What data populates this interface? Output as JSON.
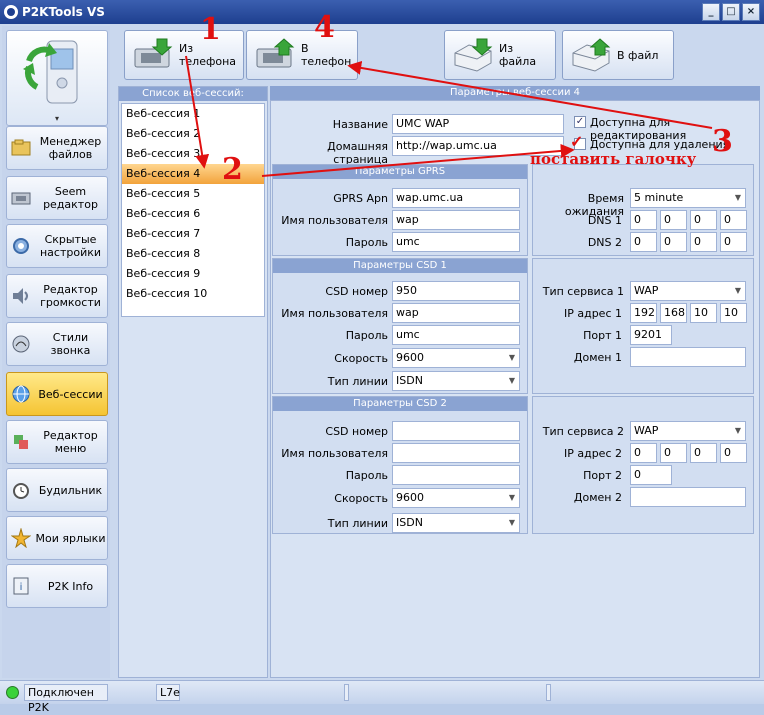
{
  "window": {
    "title": "P2KTools VS",
    "controls": [
      "_",
      "□",
      "×"
    ]
  },
  "nav": {
    "items": [
      {
        "label": "Менеджер\nфайлов",
        "icon": "file-manager-icon"
      },
      {
        "label": "Seem\nредактор",
        "icon": "seem-editor-icon"
      },
      {
        "label": "Скрытые\nнастройки",
        "icon": "hidden-settings-icon"
      },
      {
        "label": "Редактор\nгромкости",
        "icon": "volume-editor-icon"
      },
      {
        "label": "Стили звонка",
        "icon": "ring-styles-icon"
      },
      {
        "label": "Веб-сессии",
        "icon": "web-sessions-icon",
        "active": true
      },
      {
        "label": "Редактор\nменю",
        "icon": "menu-editor-icon"
      },
      {
        "label": "Будильник",
        "icon": "alarm-clock-icon"
      },
      {
        "label": "Мои ярлыки",
        "icon": "shortcuts-icon"
      },
      {
        "label": "P2K Info",
        "icon": "p2k-info-icon"
      }
    ]
  },
  "toolbar": {
    "from_phone": "Из телефона",
    "to_phone": "В телефон",
    "from_file": "Из файла",
    "to_file": "В файл"
  },
  "sessions": {
    "header": "Список веб-сессий:",
    "items": [
      "Веб-сессия 1",
      "Веб-сессия 2",
      "Веб-сессия 3",
      "Веб-сессия 4",
      "Веб-сессия 5",
      "Веб-сессия 6",
      "Веб-сессия 7",
      "Веб-сессия 8",
      "Веб-сессия 9",
      "Веб-сессия 10"
    ],
    "selected_index": 3
  },
  "params": {
    "header": "Параметры веб-сессии 4",
    "name_label": "Название",
    "name_value": "UMC WAP",
    "home_label": "Домашняя страница",
    "home_value": "http://wap.umc.ua",
    "editable_label": "Доступна для редактирования",
    "editable_checked": true,
    "deletable_label": "Доступна для удаления",
    "deletable_checked": true
  },
  "gprs": {
    "title": "Параметры GPRS",
    "apn_label": "GPRS Apn",
    "apn_value": "wap.umc.ua",
    "user_label": "Имя пользователя",
    "user_value": "wap",
    "pass_label": "Пароль",
    "pass_value": "umc"
  },
  "timing": {
    "timeout_label": "Время ожидания",
    "timeout_value": "5 minute",
    "dns1_label": "DNS 1",
    "dns1": [
      "0",
      "0",
      "0",
      "0"
    ],
    "dns2_label": "DNS 2",
    "dns2": [
      "0",
      "0",
      "0",
      "0"
    ]
  },
  "csd1": {
    "title": "Параметры CSD 1",
    "number_label": "CSD номер",
    "number_value": "950",
    "user_label": "Имя пользователя",
    "user_value": "wap",
    "pass_label": "Пароль",
    "pass_value": "umc",
    "speed_label": "Скорость",
    "speed_value": "9600",
    "line_label": "Тип линии",
    "line_value": "ISDN"
  },
  "svc1": {
    "type_label": "Тип сервиса 1",
    "type_value": "WAP",
    "ip_label": "IP адрес 1",
    "ip": [
      "192",
      "168",
      "10",
      "10"
    ],
    "port_label": "Порт 1",
    "port_value": "9201",
    "domain_label": "Домен 1",
    "domain_value": ""
  },
  "csd2": {
    "title": "Параметры CSD 2",
    "number_label": "CSD номер",
    "number_value": "",
    "user_label": "Имя пользователя",
    "user_value": "",
    "pass_label": "Пароль",
    "pass_value": "",
    "speed_label": "Скорость",
    "speed_value": "9600",
    "line_label": "Тип линии",
    "line_value": "ISDN"
  },
  "svc2": {
    "type_label": "Тип сервиса 2",
    "type_value": "WAP",
    "ip_label": "IP адрес 2",
    "ip": [
      "0",
      "0",
      "0",
      "0"
    ],
    "port_label": "Порт 2",
    "port_value": "0",
    "domain_label": "Домен 2",
    "domain_value": ""
  },
  "status": {
    "connection": "Подключен P2K",
    "model": "L7e"
  },
  "annotations": {
    "n1": "1",
    "n2": "2",
    "n3": "3",
    "n4": "4",
    "hint": "поставить галочку",
    "color": "#e01010"
  }
}
